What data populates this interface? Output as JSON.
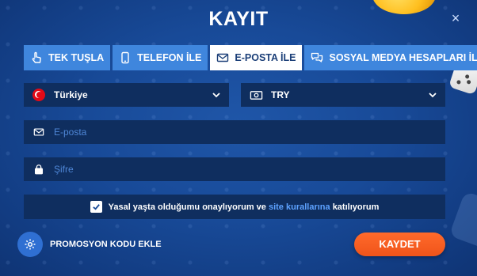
{
  "title": "KAYIT",
  "close_label": "×",
  "tabs": [
    {
      "label": "TEK TUŞLA",
      "icon": "hand-pointer-icon",
      "active": false
    },
    {
      "label": "TELEFON İLE",
      "icon": "phone-icon",
      "active": false
    },
    {
      "label": "E-POSTA İLE",
      "icon": "envelope-icon",
      "active": true
    },
    {
      "label": "SOSYAL MEDYA HESAPLARI İLE",
      "icon": "chat-bubbles-icon",
      "active": false
    }
  ],
  "country_select": {
    "value": "Türkiye",
    "icon": "turkey-flag-icon"
  },
  "currency_select": {
    "value": "TRY",
    "icon": "banknote-icon"
  },
  "email_field": {
    "placeholder": "E-posta",
    "value": "",
    "icon": "envelope-icon"
  },
  "password_field": {
    "placeholder": "Şifre",
    "value": "",
    "icon": "lock-icon"
  },
  "consent": {
    "checked": true,
    "text_before": "Yasal yaşta olduğumu onaylıyorum ve",
    "link_text": "site kurallarına",
    "text_after": "katılıyorum"
  },
  "promo": {
    "label": "PROMOSYON KODU EKLE",
    "icon": "gear-icon"
  },
  "save_label": "KAYDET",
  "colors": {
    "background": "#184a98",
    "tab_inactive": "#3f86dd",
    "tab_active": "#ffffff",
    "field": "#0f2e5f",
    "accent_button": "#f0541a",
    "link": "#5da2ff"
  }
}
